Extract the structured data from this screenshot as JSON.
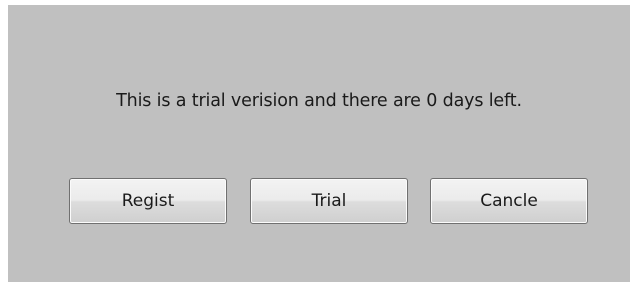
{
  "dialog": {
    "message": "This is a trial verision and there are 0 days left.",
    "buttons": {
      "regist": "Regist",
      "trial": "Trial",
      "cancle": "Cancle"
    }
  },
  "colors": {
    "dialog_background": "#c0c0c0",
    "button_border": "#707070",
    "text": "#1a1a1a"
  }
}
